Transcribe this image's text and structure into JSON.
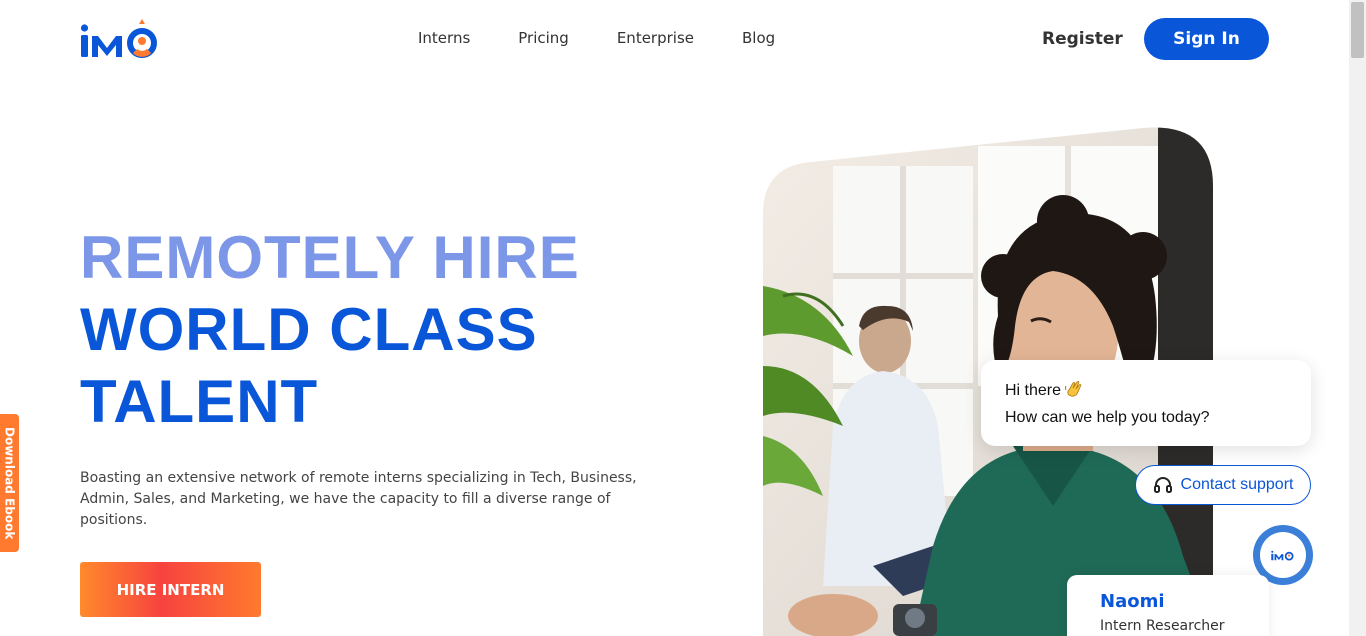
{
  "brand": {
    "logo_text": "iMO",
    "primary": "#0a56d9",
    "accent": "#ff7a2e",
    "headline_light": "#7d97e8"
  },
  "nav": {
    "items": [
      "Interns",
      "Pricing",
      "Enterprise",
      "Blog"
    ]
  },
  "header": {
    "register_label": "Register",
    "signin_label": "Sign In"
  },
  "hero": {
    "line1": "REMOTELY HIRE",
    "line2": "WORLD CLASS",
    "line3": "TALENT",
    "description": "Boasting an extensive network of remote interns specializing in Tech, Business, Admin, Sales, and Marketing, we have the capacity to fill a diverse range of positions.",
    "cta_label": "HIRE INTERN"
  },
  "side_tab": {
    "label": "Download Ebook"
  },
  "chat": {
    "greeting": "Hi there",
    "greeting_icon": "waving-hand-icon",
    "question": "How can we help you today?",
    "contact_label": "Contact support",
    "contact_icon": "headset-icon",
    "launcher_icon": "imo-logo-icon"
  },
  "profile_card": {
    "name": "Naomi",
    "role": "Intern Researcher"
  }
}
